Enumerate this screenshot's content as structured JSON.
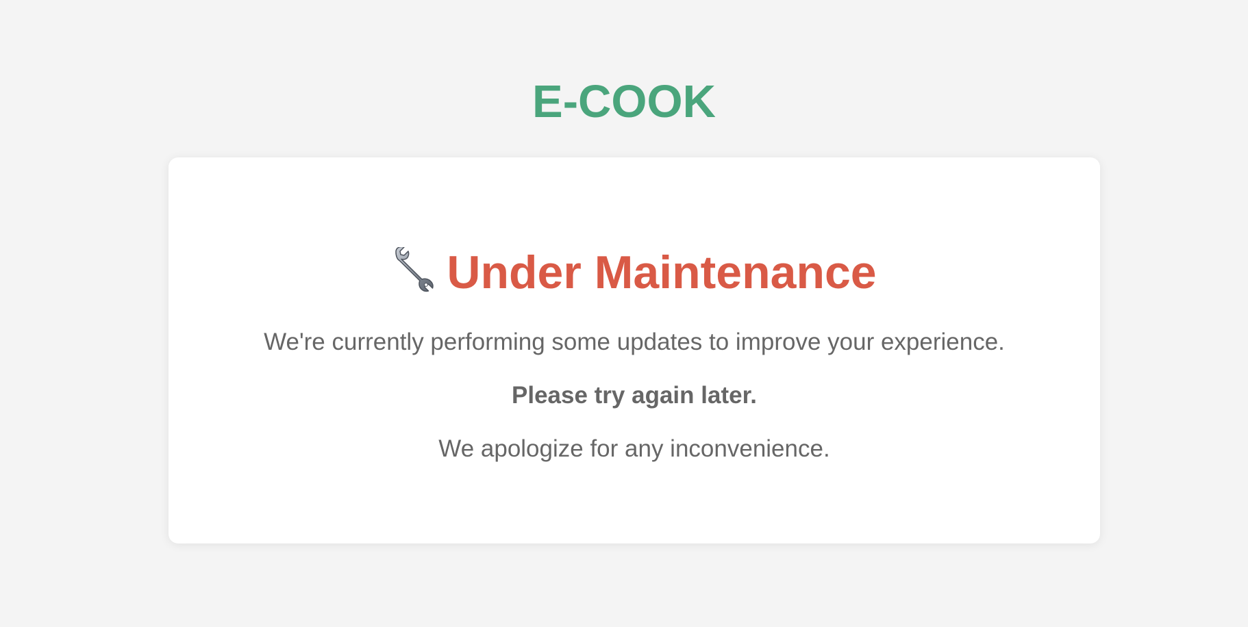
{
  "brand": {
    "name": "E-COOK",
    "color": "#4aa57c"
  },
  "maintenance": {
    "icon": "wrench-icon",
    "title": "Under Maintenance",
    "title_color": "#d95a46",
    "message": "We're currently performing some updates to improve your experience.",
    "retry_notice": "Please try again later.",
    "apology": "We apologize for any inconvenience."
  }
}
